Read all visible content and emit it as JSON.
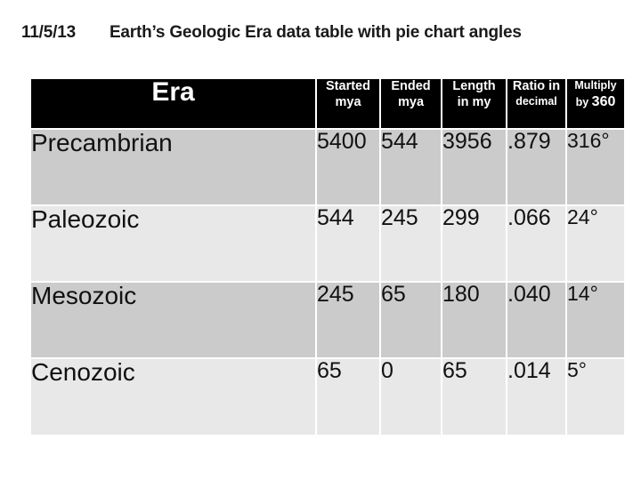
{
  "slide": {
    "date": "11/5/13",
    "heading": "Earth’s Geologic Era data table with pie chart angles"
  },
  "table": {
    "headers": {
      "era": "Era",
      "started_line1": "Started",
      "started_line2": "mya",
      "ended_line1": "Ended",
      "ended_line2": "mya",
      "length_line1": "Length",
      "length_line2": "in my",
      "ratio_line1": "Ratio in",
      "ratio_line2": "decimal",
      "multiply_line1": "Multiply",
      "multiply_line2_prefix": "by ",
      "multiply_line2_value": "360"
    },
    "rows": [
      {
        "era": "Precambrian",
        "started_mya": "5400",
        "ended_mya": "544",
        "length_my": "3956",
        "ratio_decimal": ".879",
        "angle_degrees": "316°"
      },
      {
        "era": "Paleozoic",
        "started_mya": "544",
        "ended_mya": "245",
        "length_my": "299",
        "ratio_decimal": ".066",
        "angle_degrees": "24°"
      },
      {
        "era": "Mesozoic",
        "started_mya": "245",
        "ended_mya": "65",
        "length_my": "180",
        "ratio_decimal": ".040",
        "angle_degrees": "14°"
      },
      {
        "era": "Cenozoic",
        "started_mya": "65",
        "ended_mya": "0",
        "length_my": "65",
        "ratio_decimal": ".014",
        "angle_degrees": "5°"
      }
    ]
  },
  "chart_data": {
    "type": "table",
    "title": "Earth’s Geologic Era data table with pie chart angles",
    "columns": [
      "Era",
      "Started mya",
      "Ended mya",
      "Length in my",
      "Ratio in decimal",
      "Multiply by 360"
    ],
    "categories": [
      "Precambrian",
      "Paleozoic",
      "Mesozoic",
      "Cenozoic"
    ],
    "series": [
      {
        "name": "Started mya",
        "values": [
          5400,
          544,
          245,
          65
        ]
      },
      {
        "name": "Ended mya",
        "values": [
          544,
          245,
          65,
          0
        ]
      },
      {
        "name": "Length in my",
        "values": [
          3956,
          299,
          180,
          65
        ]
      },
      {
        "name": "Ratio in decimal",
        "values": [
          0.879,
          0.066,
          0.04,
          0.014
        ]
      },
      {
        "name": "Multiply by 360",
        "values": [
          316,
          24,
          14,
          5
        ]
      }
    ]
  },
  "colors": {
    "header_background": "#000000",
    "header_text": "#ffffff",
    "row_band_dark": "#cbcbcb",
    "row_band_light": "#e8e8e8",
    "page_background": "#ffffff",
    "body_text": "#111111"
  }
}
